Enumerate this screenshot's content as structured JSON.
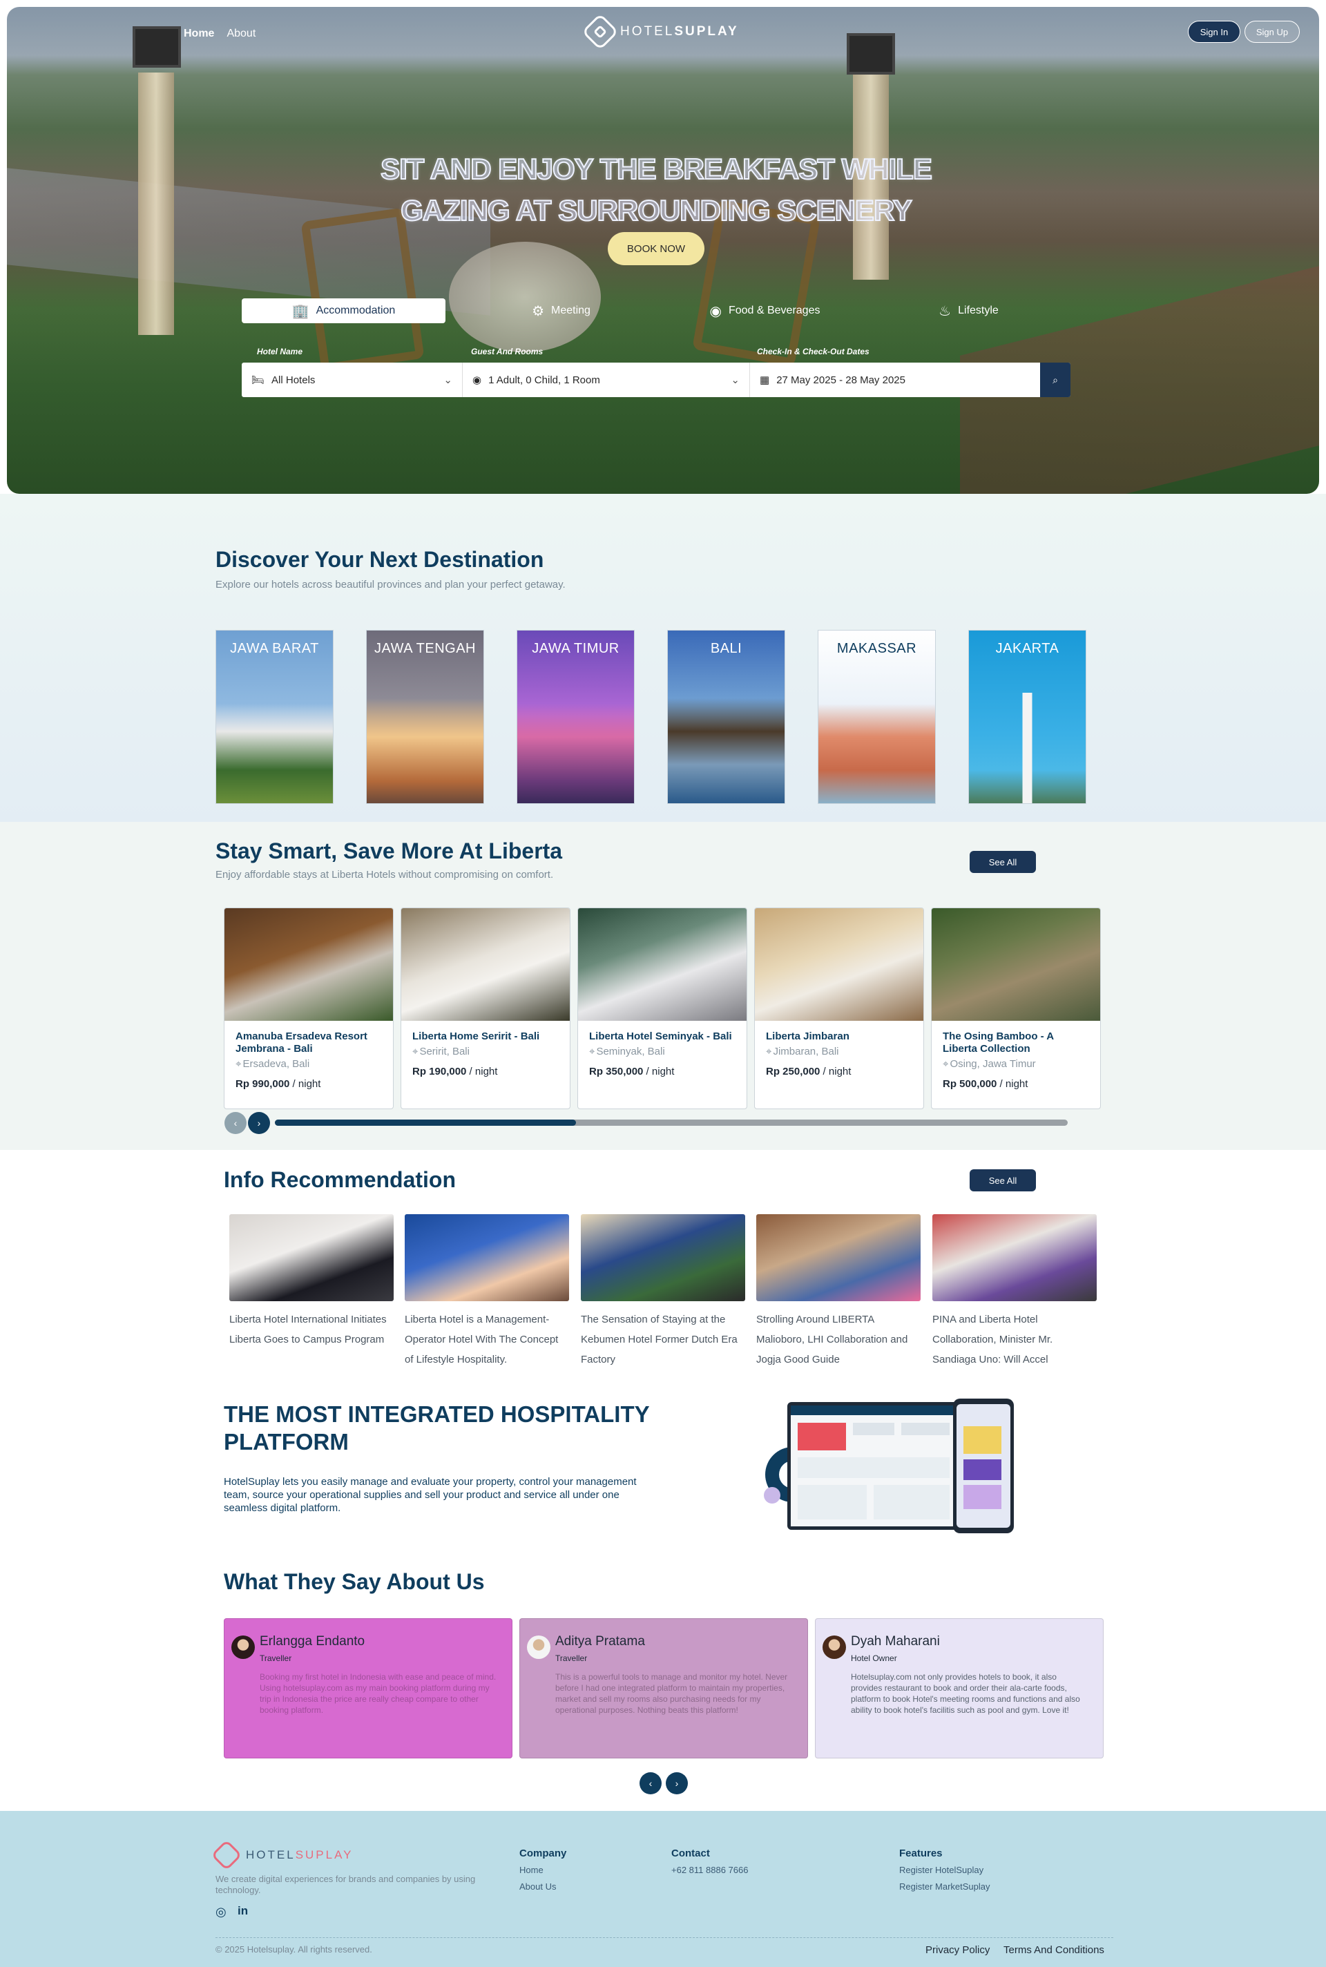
{
  "nav": {
    "home": "Home",
    "about": "About",
    "sign_in": "Sign In",
    "sign_up": "Sign Up"
  },
  "brand": {
    "hotel": "HOTEL",
    "suplay": "SUPLAY"
  },
  "hero": {
    "title_line1": "SIT AND ENJOY THE BREAKFAST WHILE",
    "title_line2": "GAZING AT SURROUNDING SCENERY",
    "book_now": "BOOK NOW"
  },
  "tabs": [
    {
      "label": "Accommodation",
      "icon": "building-icon"
    },
    {
      "label": "Meeting",
      "icon": "gear-icon"
    },
    {
      "label": "Food & Beverages",
      "icon": "food-icon"
    },
    {
      "label": "Lifestyle",
      "icon": "lifestyle-icon"
    }
  ],
  "search": {
    "hotel_label": "Hotel Name",
    "hotel_value": "All Hotels",
    "guest_label": "Guest And Rooms",
    "guest_value": "1 Adult, 0 Child, 1 Room",
    "dates_label": "Check-In & Check-Out Dates",
    "dates_value": "27 May 2025 - 28 May 2025"
  },
  "discover": {
    "title": "Discover Your Next Destination",
    "subtitle": "Explore our hotels across beautiful provinces and plan your perfect getaway.",
    "destinations": [
      "JAWA BARAT",
      "JAWA TENGAH",
      "JAWA TIMUR",
      "BALI",
      "MAKASSAR",
      "JAKARTA"
    ]
  },
  "stay": {
    "title": "Stay Smart, Save More At Liberta",
    "subtitle": "Enjoy affordable stays at Liberta Hotels without compromising on comfort.",
    "see_all": "See All",
    "hotels": [
      {
        "name": "Amanuba Ersadeva Resort Jembrana - Bali",
        "location": "Ersadeva, Bali",
        "price": "Rp 990,000",
        "unit": " / night"
      },
      {
        "name": "Liberta Home Seririt - Bali",
        "location": "Seririt, Bali",
        "price": "Rp 190,000",
        "unit": " / night"
      },
      {
        "name": "Liberta Hotel Seminyak - Bali",
        "location": "Seminyak, Bali",
        "price": "Rp 350,000",
        "unit": " / night"
      },
      {
        "name": "Liberta Jimbaran",
        "location": "Jimbaran, Bali",
        "price": "Rp 250,000",
        "unit": " / night"
      },
      {
        "name": "The Osing Bamboo - A Liberta Collection",
        "location": "Osing, Jawa Timur",
        "price": "Rp 500,000",
        "unit": " / night"
      }
    ],
    "scroll_progress": 0.38
  },
  "info": {
    "title": "Info Recommendation",
    "see_all": "See All",
    "articles": [
      "Liberta Hotel International Initiates Liberta Goes to Campus Program",
      "Liberta Hotel is a Management-Operator Hotel With The Concept of Lifestyle Hospitality.",
      "The Sensation of Staying at the Kebumen Hotel Former Dutch Era Factory",
      "Strolling Around LIBERTA Malioboro, LHI Collaboration and Jogja Good Guide",
      "PINA and Liberta Hotel Collaboration, Minister Mr. Sandiaga Uno: Will Accel"
    ]
  },
  "platform": {
    "title": "THE MOST INTEGRATED HOSPITALITY PLATFORM",
    "desc": "HotelSuplay lets you easily manage and evaluate your property, control your management team, source your operational supplies and sell your product and service all under one seamless digital platform."
  },
  "testimonials": {
    "title": "What They Say About Us",
    "items": [
      {
        "name": "Erlangga Endanto",
        "role": "Traveller",
        "quote": "Booking my first hotel in Indonesia with ease and peace of mind. Using hotelsuplay.com as my main booking platform during my trip in Indonesia the price are really cheap compare to other booking platform.",
        "bg": "#d76ad0",
        "quote_color": "#a24f9c"
      },
      {
        "name": "Aditya Pratama",
        "role": "Traveller",
        "quote": "This is a powerful tools to manage and monitor my hotel. Never before I had one integrated platform to maintain my properties, market and sell my rooms also purchasing needs for my operational purposes. Nothing beats this platform!",
        "bg": "#c89ac6",
        "quote_color": "#8e6a8c"
      },
      {
        "name": "Dyah Maharani",
        "role": "Hotel Owner",
        "quote": "Hotelsuplay.com not only provides hotels to book, it also provides restaurant to book and order their ala-carte foods, platform to book Hotel's meeting rooms and functions and also ability to book hotel's facilitis such as pool and gym. Love it!",
        "bg": "#e8e4f6",
        "quote_color": "#5a6470"
      }
    ]
  },
  "footer": {
    "tagline": "We create digital experiences for brands and companies by using technology.",
    "company_title": "Company",
    "company_items": [
      "Home",
      "About Us"
    ],
    "contact_title": "Contact",
    "contact_phone": "+62 811 8886 7666",
    "features_title": "Features",
    "features_items": [
      "Register HotelSuplay",
      "Register MarketSuplay"
    ],
    "copyright": "© 2025 Hotelsuplay. All rights reserved.",
    "privacy": "Privacy Policy",
    "terms": "Terms And Conditions"
  },
  "colors": {
    "primary": "#1b3556",
    "heading": "#0f3d5e",
    "book": "#f3e6a1",
    "footer": "#bcdde7"
  }
}
